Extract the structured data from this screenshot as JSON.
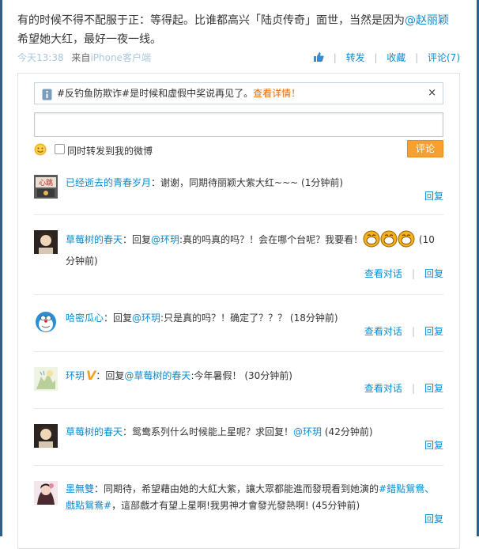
{
  "post": {
    "line1": "有的时候不得不配服于正：等得起。比谁都高兴「陆贞传奇」面世，当然是因为",
    "mention": "@赵丽颖",
    "line2": "希望她大红，最好一夜一线。",
    "time": "今天13:38",
    "source_label": "来自",
    "source": "iPhone客户端"
  },
  "actions": {
    "forward": "转发",
    "favorite": "收藏",
    "comment": "评论(7)"
  },
  "notice": {
    "text": "#反钓鱼防欺诈#是时候和虚假中奖说再见了。",
    "link": "查看详情！",
    "close": "×"
  },
  "composer": {
    "placeholder": "",
    "forward_checkbox_label": "同时转发到我的微博",
    "submit_label": "评论"
  },
  "comments": [
    {
      "name": "已经逝去的青春岁月",
      "text": "：谢谢，同期待丽颖大紫大红~~~",
      "time": "(1分钟前)",
      "reply": "回复"
    },
    {
      "name": "草莓树的春天",
      "prefix": "：回复",
      "mention": "@环玥",
      "text": ":真的吗真的吗？！会在哪个台呢？我要看！",
      "time": "(10分钟前)",
      "view_conversation": "查看对话",
      "reply": "回复"
    },
    {
      "name": "哈密瓜心",
      "prefix": "：回复",
      "mention": "@环玥",
      "text": ":只是真的吗？！确定了？？？",
      "time": "(18分钟前)",
      "view_conversation": "查看对话",
      "reply": "回复"
    },
    {
      "name": "环玥",
      "badge": "V",
      "prefix": "：回复",
      "mention": "@草莓树的春天",
      "text": ":今年暑假！",
      "time": "(30分钟前)",
      "view_conversation": "查看对话",
      "reply": "回复"
    },
    {
      "name": "草莓树的春天",
      "text": "：鸳鸯系列什么时候能上星呢？求回复！",
      "mention": "@环玥",
      "time": "(42分钟前)",
      "reply": "回复"
    },
    {
      "name": "墨無雙",
      "text": "：同期待，希望藉由她的大紅大紫，讓大眾都能進而發現看到她演的",
      "hashtag": "#錯點鴛鴦、戲點鴛鴦#",
      "text2": "，這部戲才有望上星啊!我男神才會發光發熱啊!",
      "time": "(45分钟前)",
      "reply": "回复"
    }
  ],
  "colors": {
    "link": "#0a8cd2",
    "accent_orange": "#f5a030",
    "notice_link": "#ec6800",
    "frame": "#2d5f8a"
  }
}
